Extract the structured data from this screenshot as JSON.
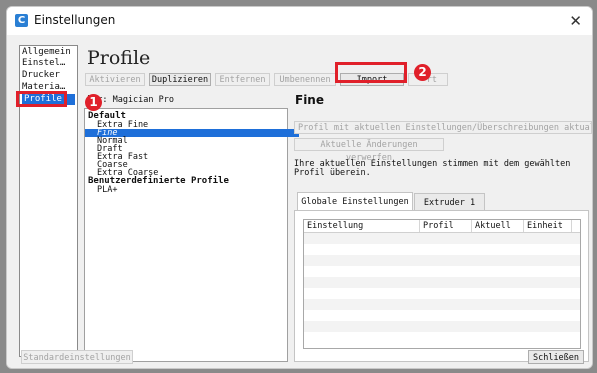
{
  "window": {
    "title": "Einstellungen",
    "close_glyph": "✕",
    "app_icon": "C"
  },
  "sidebar": {
    "items": [
      {
        "label": "Allgemein"
      },
      {
        "label": "Einstel…"
      },
      {
        "label": "Drucker"
      },
      {
        "label": "Materia…"
      },
      {
        "label": "Profile"
      }
    ],
    "selected": "Profile"
  },
  "page": {
    "title": "Profile"
  },
  "toolbar": {
    "activate": "Aktivieren",
    "duplicate": "Duplizieren",
    "remove": "Entfernen",
    "rename": "Umbenennen",
    "import": "Import",
    "export_partial": "rt"
  },
  "printer": {
    "label": "ker: Magician Pro"
  },
  "profiles": {
    "group_default": "Default",
    "default_items": [
      "Extra Fine",
      "Fine",
      "Normal",
      "Draft",
      "Extra Fast",
      "Coarse",
      "Extra Coarse"
    ],
    "selected": "Fine",
    "group_custom": "Benutzerdefinierte Profile",
    "custom_items": [
      "PLA+"
    ]
  },
  "detail": {
    "title": "Fine",
    "update_button": "Profil mit aktuellen Einstellungen/Überschreibungen aktualisie",
    "discard_button": "Aktuelle Änderungen verwerfen",
    "info": "Ihre aktuellen Einstellungen stimmen mit dem gewählten Profil überein."
  },
  "tabs": [
    {
      "label": "Globale Einstellungen",
      "active": true
    },
    {
      "label": "Extruder 1",
      "active": false
    }
  ],
  "table": {
    "columns": [
      "Einstellung",
      "Profil",
      "Aktuell",
      "Einheit"
    ]
  },
  "footer": {
    "defaults": "Standardeinstellungen",
    "close": "Schließen"
  },
  "annotations": {
    "badge1": "1",
    "badge2": "2",
    "color": "#e0202a"
  },
  "colors": {
    "selection": "#1e6fd9",
    "accent": "#2a7fd4"
  }
}
